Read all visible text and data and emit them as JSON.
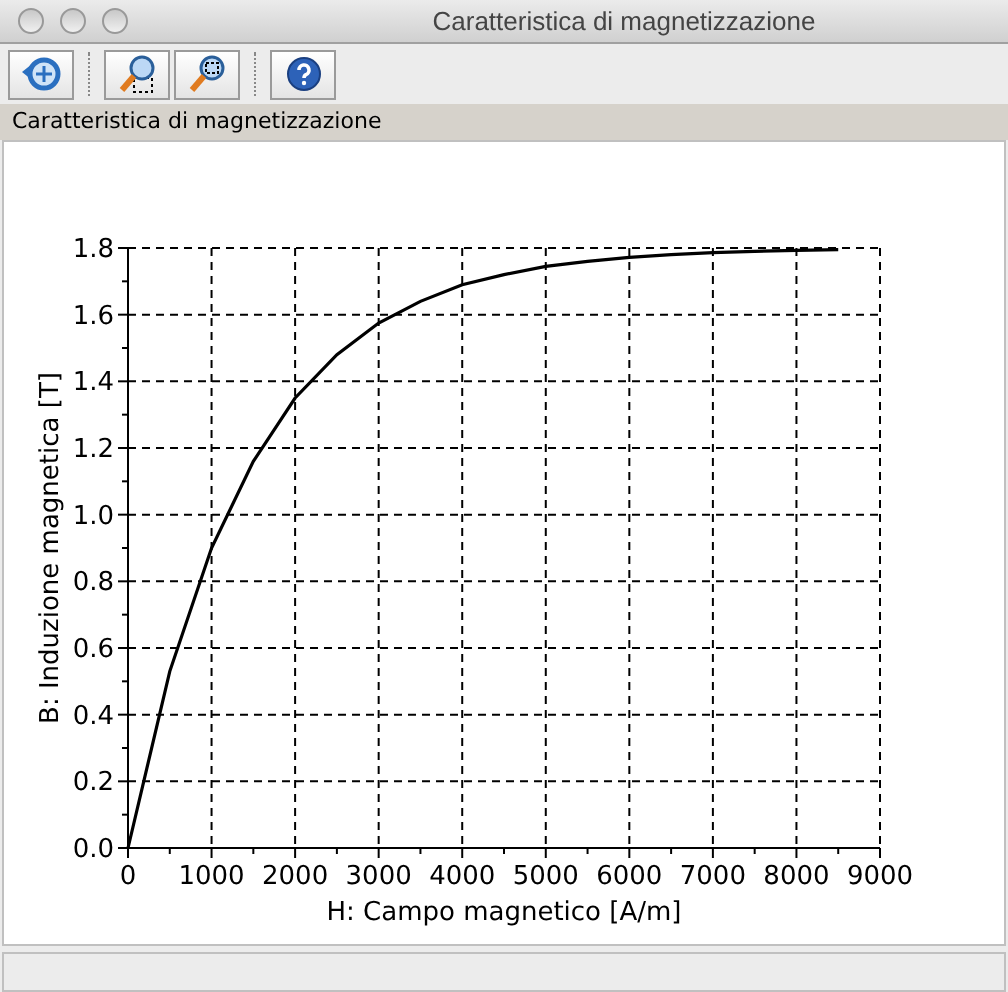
{
  "window": {
    "title": "Caratteristica di magnetizzazione"
  },
  "toolbar": [
    {
      "kind": "reset"
    },
    {
      "kind": "separator"
    },
    {
      "kind": "zoom-box"
    },
    {
      "kind": "zoom-fit"
    },
    {
      "kind": "separator"
    },
    {
      "kind": "help"
    }
  ],
  "panel": {
    "title": "Caratteristica di magnetizzazione",
    "chart_data": {
      "type": "line",
      "xlabel": "H: Campo magnetico [A/m]",
      "ylabel": "B: Induzione magnetica [T]",
      "x": [
        0,
        500,
        1000,
        1500,
        2000,
        2500,
        3000,
        3500,
        4000,
        4500,
        5000,
        5500,
        6000,
        6500,
        7000,
        7500,
        8000,
        8500
      ],
      "grid": true,
      "series": [
        {
          "color": "#000000",
          "values": [
            0,
            0.53,
            0.9,
            1.16,
            1.35,
            1.48,
            1.575,
            1.64,
            1.69,
            1.72,
            1.745,
            1.76,
            1.772,
            1.78,
            1.786,
            1.79,
            1.793,
            1.795
          ]
        }
      ],
      "xlim": [
        0,
        9000
      ],
      "ylim": [
        0,
        1.8
      ],
      "xticks": [
        0,
        1000,
        2000,
        3000,
        4000,
        5000,
        6000,
        7000,
        8000,
        9000
      ],
      "yticks": [
        {
          "value": 0,
          "label": "0.0"
        },
        {
          "value": 0.2,
          "label": "0.2"
        },
        {
          "value": 0.4,
          "label": "0.4"
        },
        {
          "value": 0.6,
          "label": "0.6"
        },
        {
          "value": 0.8,
          "label": "0.8"
        },
        {
          "value": 1.0,
          "label": "1.0"
        },
        {
          "value": 1.2,
          "label": "1.2"
        },
        {
          "value": 1.4,
          "label": "1.4"
        },
        {
          "value": 1.6,
          "label": "1.6"
        },
        {
          "value": 1.8,
          "label": "1.8"
        }
      ]
    }
  }
}
